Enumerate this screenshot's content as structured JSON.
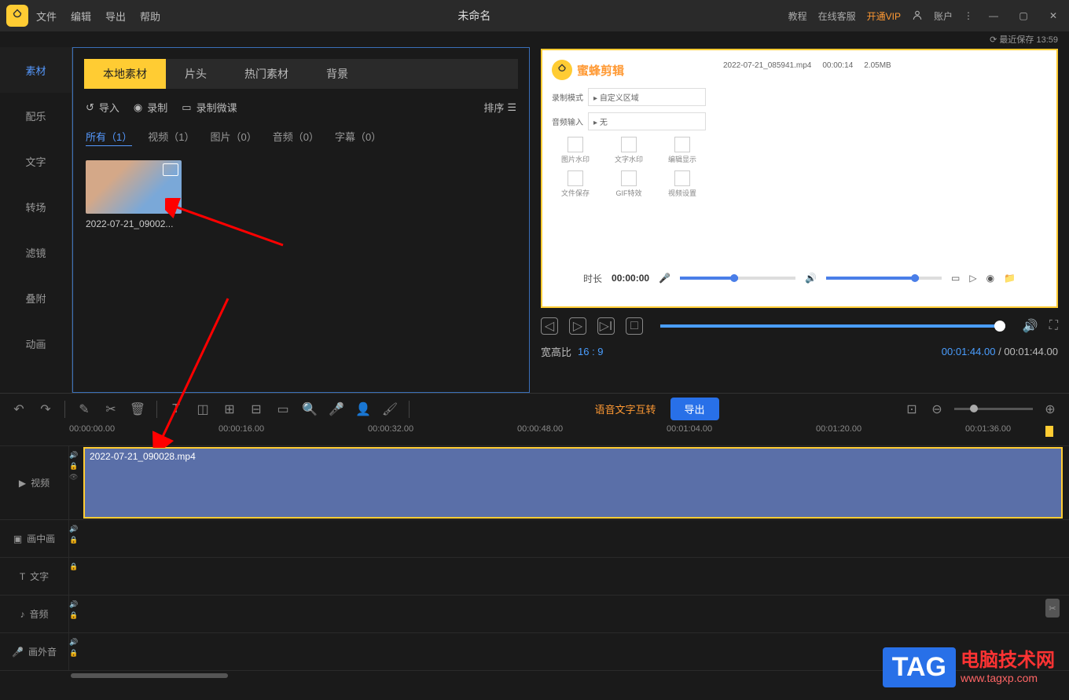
{
  "titlebar": {
    "menus": [
      "文件",
      "编辑",
      "导出",
      "帮助"
    ],
    "title": "未命名",
    "right": {
      "tutorial": "教程",
      "service": "在线客服",
      "vip": "开通VIP",
      "account": "账户"
    }
  },
  "save_status": "最近保存 13:59",
  "left_tabs": [
    "素材",
    "配乐",
    "文字",
    "转场",
    "滤镜",
    "叠附",
    "动画"
  ],
  "media": {
    "tabs": [
      "本地素材",
      "片头",
      "热门素材",
      "背景"
    ],
    "import": "导入",
    "record": "录制",
    "record_course": "录制微课",
    "sort": "排序",
    "filters": {
      "all": "所有（1）",
      "video": "视频（1）",
      "image": "图片（0）",
      "audio": "音频（0）",
      "subtitle": "字幕（0）"
    },
    "thumb_label": "2022-07-21_09002..."
  },
  "preview": {
    "brand": "蜜蜂剪辑",
    "form": {
      "mode_label": "录制模式",
      "mode_value": "自定义区域",
      "audio_label": "音频输入",
      "audio_value": "无"
    },
    "grid_items": [
      "图片水印",
      "文字水印",
      "编辑显示",
      "文件保存",
      "GIF特效",
      "视频设置"
    ],
    "list_file": "2022-07-21_085941.mp4",
    "list_dur": "00:00:14",
    "list_size": "2.05MB",
    "player_label": "时长",
    "player_time": "00:00:00"
  },
  "playback": {
    "aspect_label": "宽高比",
    "aspect_value": "16 : 9",
    "time_current": "00:01:44.00",
    "time_total": "00:01:44.00"
  },
  "toolbar": {
    "voice": "语音文字互转",
    "export": "导出"
  },
  "timeline": {
    "marks": [
      "00:00:00.00",
      "00:00:16.00",
      "00:00:32.00",
      "00:00:48.00",
      "00:01:04.00",
      "00:01:20.00",
      "00:01:36.00"
    ],
    "clip_name": "2022-07-21_090028.mp4",
    "tracks": {
      "video": "视频",
      "pip": "画中画",
      "text": "文字",
      "audio": "音频",
      "voice": "画外音"
    }
  },
  "watermark": {
    "badge": "TAG",
    "title": "电脑技术网",
    "url": "www.tagxp.com"
  }
}
